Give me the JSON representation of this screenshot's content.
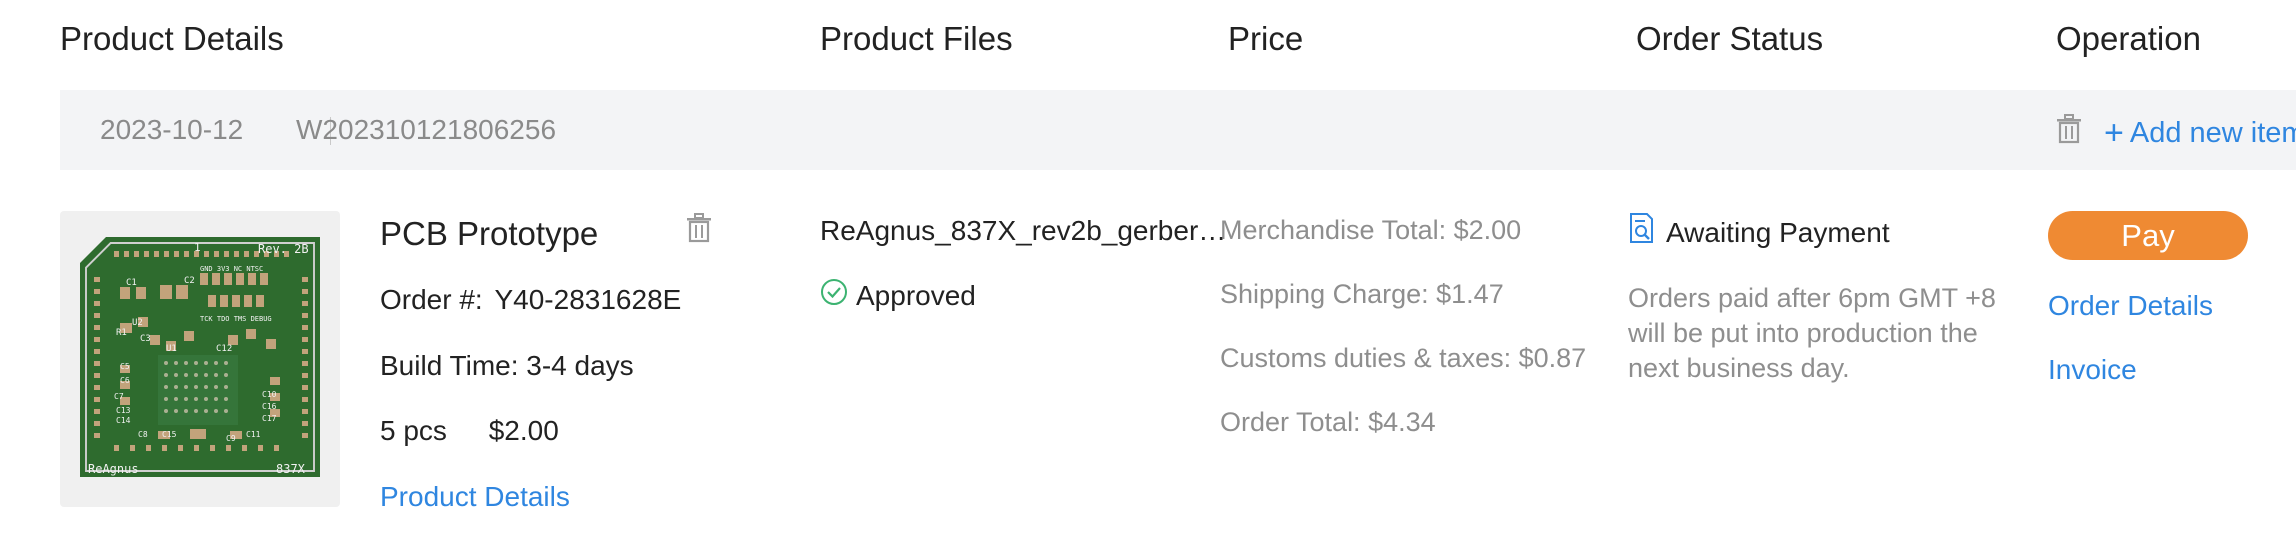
{
  "headers": {
    "product_details": "Product Details",
    "product_files": "Product Files",
    "price": "Price",
    "order_status": "Order Status",
    "operation": "Operation"
  },
  "order_bar": {
    "date": "2023-10-12",
    "order_id": "W202310121806256",
    "add_new_item": "Add new item"
  },
  "product": {
    "name": "PCB Prototype",
    "order_no_label": "Order #:",
    "order_no": "Y40-2831628E",
    "build_time": "Build Time: 3-4 days",
    "quantity": "5 pcs",
    "unit_price": "$2.00",
    "details_link": "Product Details",
    "board_text": {
      "rev": "Rev. 2B",
      "top_num": "1",
      "name_left": "ReAgnus",
      "name_right": "837X",
      "header_row": "GND 3V3 NC NTSC",
      "jtag_row": "TCK TDO TMS DEBUG"
    }
  },
  "files": {
    "filename": "ReAgnus_837X_rev2b_gerber…",
    "status": "Approved"
  },
  "price": {
    "merchandise_total": "Merchandise Total: $2.00",
    "shipping_charge": "Shipping Charge: $1.47",
    "customs": "Customs duties & taxes: $0.87",
    "order_total": "Order Total: $4.34"
  },
  "status": {
    "label": "Awaiting Payment",
    "note_line1": "Orders paid after 6pm GMT +8",
    "note_line2": "will be put into production the",
    "note_line3": "next business day."
  },
  "operation": {
    "pay": "Pay",
    "order_details": "Order Details",
    "invoice": "Invoice"
  },
  "colors": {
    "accent": "#2f86e0",
    "pay_button": "#ef8a33",
    "approved": "#3cb371",
    "pcb_green": "#2e6b2e"
  }
}
